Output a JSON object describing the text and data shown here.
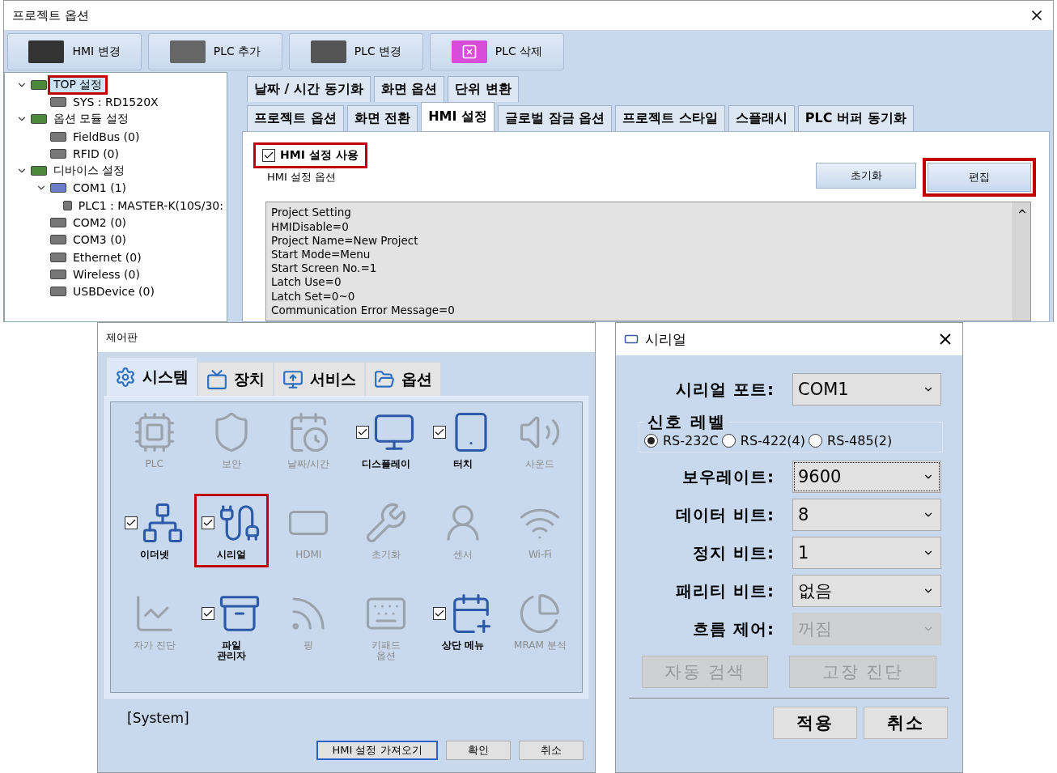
{
  "project_window": {
    "title": "프로젝트 옵션",
    "toolbar": [
      {
        "label": "HMI 변경"
      },
      {
        "label": "PLC 추가"
      },
      {
        "label": "PLC 변경"
      },
      {
        "label": "PLC 삭제"
      }
    ],
    "tree": [
      {
        "label": "TOP 설정",
        "highlighted": true,
        "expanded": true,
        "children": [
          {
            "label": "SYS : RD1520X",
            "highlighted": false
          }
        ]
      },
      {
        "label": "옵션 모듈 설정",
        "highlighted": false,
        "expanded": true,
        "children": [
          {
            "label": "FieldBus (0)",
            "highlighted": false
          },
          {
            "label": "RFID (0)",
            "highlighted": false
          }
        ]
      },
      {
        "label": "디바이스 설정",
        "highlighted": false,
        "expanded": true,
        "children": [
          {
            "label": "COM1 (1)",
            "highlighted": false,
            "expanded": true,
            "children": [
              {
                "label": "PLC1 : MASTER-K(10S/30:",
                "highlighted": false
              }
            ]
          },
          {
            "label": "COM2 (0)",
            "highlighted": false
          },
          {
            "label": "COM3 (0)",
            "highlighted": false
          },
          {
            "label": "Ethernet (0)",
            "highlighted": false
          },
          {
            "label": "Wireless (0)",
            "highlighted": false
          },
          {
            "label": "USBDevice (0)",
            "highlighted": false
          }
        ]
      }
    ],
    "tab_rows": [
      [
        {
          "label": "날짜 / 시간 동기화",
          "selected": false
        },
        {
          "label": "화면 옵션",
          "selected": false
        },
        {
          "label": "단위 변환",
          "selected": false
        }
      ],
      [
        {
          "label": "프로젝트 옵션",
          "selected": false
        },
        {
          "label": "화면 전환",
          "selected": false
        },
        {
          "label": "HMI 설정",
          "selected": true
        },
        {
          "label": "글로벌 잠금 옵션",
          "selected": false
        },
        {
          "label": "프로젝트 스타일",
          "selected": false
        },
        {
          "label": "스플래시",
          "selected": false
        },
        {
          "label": "PLC 버퍼 동기화",
          "selected": false
        }
      ]
    ],
    "use_checkbox": {
      "label": "HMI 설정 사용",
      "checked": true,
      "highlighted": true
    },
    "group_label": "HMI 설정 옵션",
    "buttons": [
      {
        "label": "초기화",
        "highlighted": false
      },
      {
        "label": "편집",
        "highlighted": true
      }
    ],
    "settings_lines": [
      "Project Setting",
      "HMIDisable=0",
      "Project Name=New Project",
      "Start Mode=Menu",
      "Start Screen No.=1",
      "Latch Use=0",
      "Latch Set=0~0",
      "Communication Error Message=0"
    ]
  },
  "control_panel": {
    "title": "제어판",
    "tabs": [
      {
        "label": "시스템",
        "selected": true
      },
      {
        "label": "장치",
        "selected": false
      },
      {
        "label": "서비스",
        "selected": false
      },
      {
        "label": "옵션",
        "selected": false
      }
    ],
    "items": [
      {
        "label": "PLC",
        "kind": "plain",
        "disabled": true,
        "highlighted": false
      },
      {
        "label": "보안",
        "kind": "plain",
        "disabled": true,
        "highlighted": false
      },
      {
        "label": "날짜/시간",
        "kind": "plain",
        "disabled": true,
        "highlighted": false
      },
      {
        "label": "디스플레이",
        "kind": "checkable",
        "checked": true,
        "disabled": false,
        "highlighted": false
      },
      {
        "label": "터치",
        "kind": "checkable",
        "checked": true,
        "disabled": false,
        "highlighted": false
      },
      {
        "label": "사운드",
        "kind": "plain",
        "disabled": true,
        "highlighted": false
      },
      {
        "label": "이더넷",
        "kind": "checkable",
        "checked": true,
        "disabled": false,
        "highlighted": false
      },
      {
        "label": "시리얼",
        "kind": "checkable",
        "checked": true,
        "disabled": false,
        "highlighted": true
      },
      {
        "label": "HDMI",
        "kind": "plain",
        "disabled": true,
        "highlighted": false
      },
      {
        "label": "초기화",
        "kind": "plain",
        "disabled": true,
        "highlighted": false
      },
      {
        "label": "센서",
        "kind": "plain",
        "disabled": true,
        "highlighted": false
      },
      {
        "label": "Wi-Fi",
        "kind": "plain",
        "disabled": true,
        "highlighted": false
      },
      {
        "label": "자가 진단",
        "kind": "plain",
        "disabled": true,
        "highlighted": false
      },
      {
        "label": "파일\n관리자",
        "kind": "checkable",
        "checked": true,
        "disabled": false,
        "highlighted": false
      },
      {
        "label": "핑",
        "kind": "plain",
        "disabled": true,
        "highlighted": false
      },
      {
        "label": "키패드\n옵션",
        "kind": "plain",
        "disabled": true,
        "highlighted": false
      },
      {
        "label": "상단 메뉴",
        "kind": "checkable",
        "checked": true,
        "disabled": false,
        "highlighted": false
      },
      {
        "label": "MRAM 분석",
        "kind": "plain",
        "disabled": true,
        "highlighted": false
      }
    ],
    "status": "[System]",
    "buttons": [
      {
        "label": "HMI 설정 가져오기",
        "focused": true
      },
      {
        "label": "확인",
        "focused": false
      },
      {
        "label": "취소",
        "focused": false
      }
    ]
  },
  "serial_dialog": {
    "title": "시리얼",
    "port": {
      "label": "시리얼 포트:",
      "value": "COM1",
      "focused": false,
      "disabled": false
    },
    "signal_level": {
      "legend": "신호 레벨",
      "options": [
        {
          "label": "RS-232C",
          "selected": true
        },
        {
          "label": "RS-422(4)",
          "selected": false
        },
        {
          "label": "RS-485(2)",
          "selected": false
        }
      ]
    },
    "fields": [
      {
        "label": "보우레이트:",
        "value": "9600",
        "focused": true,
        "disabled": false
      },
      {
        "label": "데이터 비트:",
        "value": "8",
        "focused": false,
        "disabled": false
      },
      {
        "label": "정지 비트:",
        "value": "1",
        "focused": false,
        "disabled": false
      },
      {
        "label": "패리티 비트:",
        "value": "없음",
        "focused": false,
        "disabled": false
      },
      {
        "label": "흐름 제어:",
        "value": "꺼짐",
        "focused": false,
        "disabled": true
      }
    ],
    "tool_buttons": [
      {
        "label": "자동 검색",
        "disabled": true
      },
      {
        "label": "고장 진단",
        "disabled": true
      }
    ],
    "buttons": [
      {
        "label": "적용"
      },
      {
        "label": "취소"
      }
    ]
  }
}
